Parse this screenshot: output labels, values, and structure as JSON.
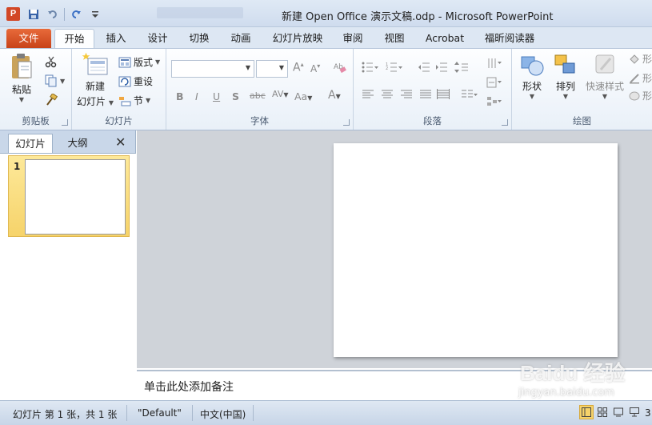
{
  "window": {
    "title": "新建 Open Office 演示文稿.odp  -  Microsoft PowerPoint",
    "app_icon_letter": "P"
  },
  "quick_access": {
    "icons": [
      "save-icon",
      "undo-icon",
      "redo-icon",
      "customize-icon"
    ]
  },
  "tabs": [
    {
      "label": "文件"
    },
    {
      "label": "开始"
    },
    {
      "label": "插入"
    },
    {
      "label": "设计"
    },
    {
      "label": "切换"
    },
    {
      "label": "动画"
    },
    {
      "label": "幻灯片放映"
    },
    {
      "label": "审阅"
    },
    {
      "label": "视图"
    },
    {
      "label": "Acrobat"
    },
    {
      "label": "福昕阅读器"
    }
  ],
  "ribbon": {
    "clipboard": {
      "label": "剪贴板",
      "paste": "粘贴"
    },
    "slides": {
      "label": "幻灯片",
      "new_slide_line1": "新建",
      "new_slide_line2": "幻灯片",
      "layout": "版式",
      "reset": "重设",
      "section": "节"
    },
    "font": {
      "label": "字体"
    },
    "paragraph": {
      "label": "段落"
    },
    "drawing": {
      "label": "绘图",
      "shapes": "形状",
      "arrange": "排列",
      "quick_styles": "快速样式",
      "right1": "形",
      "right2": "形",
      "right3": "形"
    }
  },
  "left_panel": {
    "tab_slides": "幻灯片",
    "tab_outline": "大纲",
    "close": "✕",
    "slide_number": "1"
  },
  "notes": {
    "placeholder": "单击此处添加备注"
  },
  "status": {
    "slide_info": "幻灯片 第 1 张，共 1 张",
    "theme": "\"Default\"",
    "language": "中文(中国)",
    "zoom_partial": "3"
  },
  "watermark": {
    "logo": "Baidu 经验",
    "url": "jingyan.baidu.com"
  }
}
